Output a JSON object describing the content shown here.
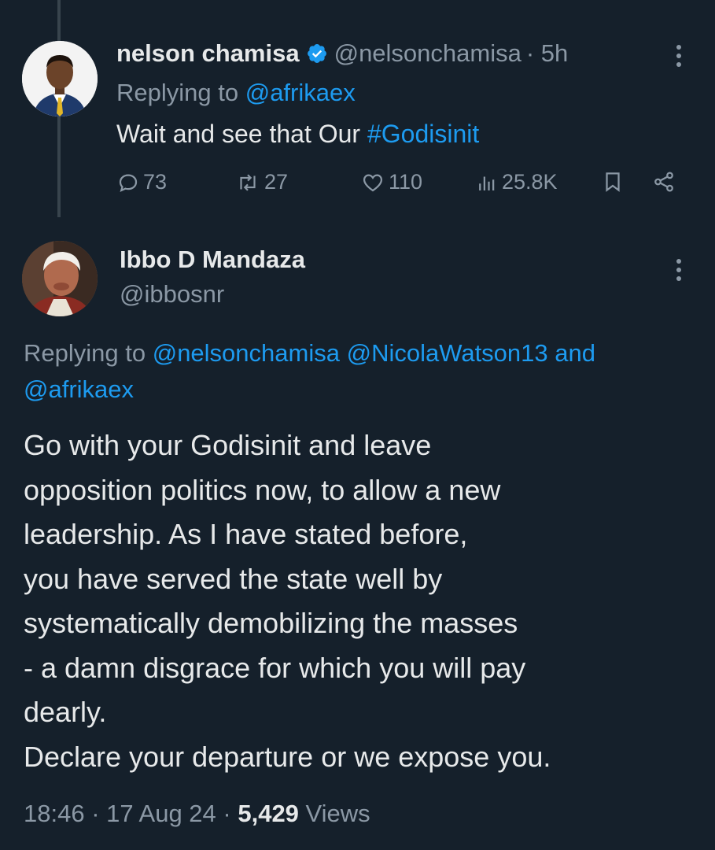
{
  "tweet1": {
    "name": "nelson chamisa",
    "handle": "@nelsonchamisa",
    "time": "· 5h",
    "replying_prefix": "Replying to ",
    "replying_to": "@afrikaex",
    "text_prefix": "Wait and see that Our ",
    "hashtag": "#Godisinit",
    "counts": {
      "replies": "73",
      "reposts": "27",
      "likes": "110",
      "views": "25.8K"
    }
  },
  "tweet2": {
    "name": "Ibbo D Mandaza",
    "handle": "@ibbosnr",
    "replying_prefix": "Replying to ",
    "replying_to_1": "@nelsonchamisa",
    "replying_to_2": "@NicolaWatson13",
    "replying_and": " and ",
    "replying_to_3": "@afrikaex",
    "body": "Go with your Godisinit and leave\nopposition politics now, to allow a new\nleadership.  As I have stated before,\nyou have served the  state well by\nsystematically demobilizing the masses\n- a damn disgrace for which you will pay\ndearly.\nDeclare your departure or we expose you.",
    "time": "18:46",
    "date": "17 Aug 24",
    "views_count": "5,429",
    "views_label": "Views"
  },
  "colors": {
    "background": "#15202b",
    "text": "#e7e9ea",
    "muted": "#8b98a5",
    "link": "#1d9bf0",
    "thread_line": "#38444d"
  },
  "icons": [
    "verified-badge-icon",
    "more-icon",
    "reply-icon",
    "repost-icon",
    "like-icon",
    "views-icon",
    "bookmark-icon",
    "share-icon"
  ]
}
